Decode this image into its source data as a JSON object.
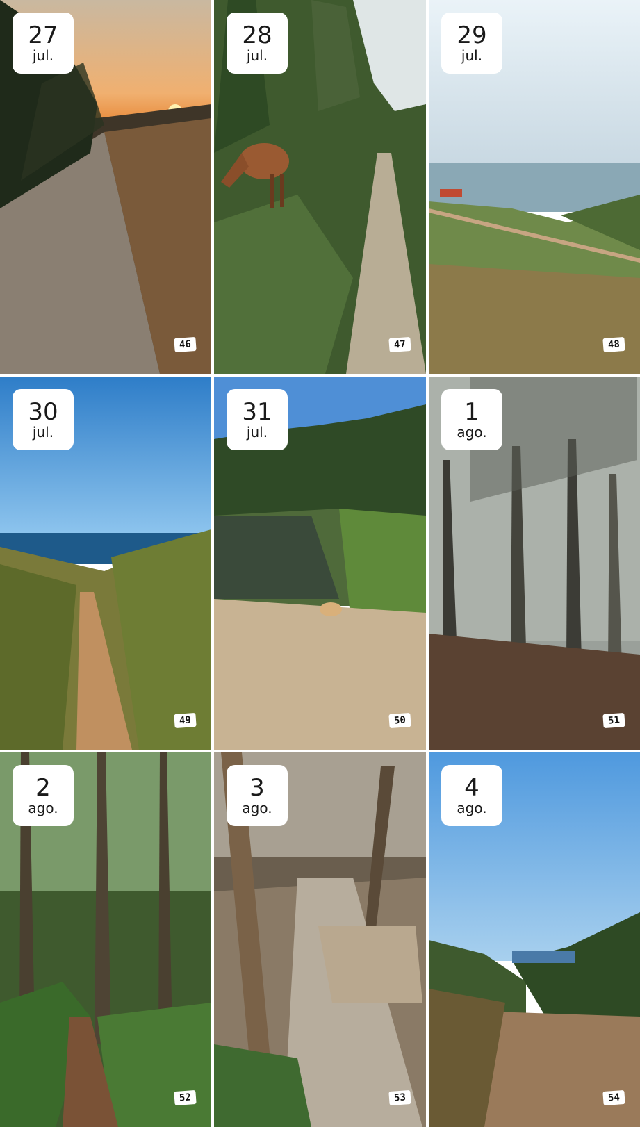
{
  "tiles": [
    {
      "day": "27",
      "month": "jul.",
      "number": "46",
      "scene": "sunset dirt road"
    },
    {
      "day": "28",
      "month": "jul.",
      "number": "47",
      "scene": "horse grazing by trail"
    },
    {
      "day": "29",
      "month": "jul.",
      "number": "48",
      "scene": "coastal heath and sea"
    },
    {
      "day": "30",
      "month": "jul.",
      "number": "49",
      "scene": "path to blue sea"
    },
    {
      "day": "31",
      "month": "jul.",
      "number": "50",
      "scene": "pond with dog"
    },
    {
      "day": "1",
      "month": "ago.",
      "number": "51",
      "scene": "foggy forest"
    },
    {
      "day": "2",
      "month": "ago.",
      "number": "52",
      "scene": "green forest trail"
    },
    {
      "day": "3",
      "month": "ago.",
      "number": "53",
      "scene": "wooden boardwalk in woods"
    },
    {
      "day": "4",
      "month": "ago.",
      "number": "54",
      "scene": "trail to sea"
    }
  ]
}
